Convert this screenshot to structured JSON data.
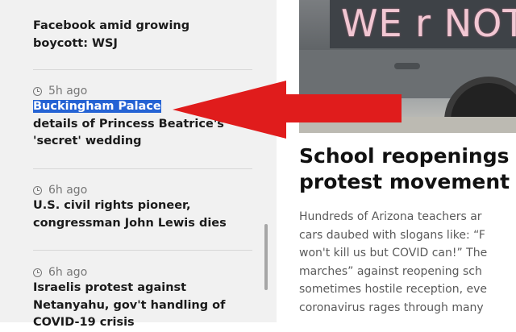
{
  "sidebar": {
    "items": [
      {
        "time": "",
        "headline_lines": [
          "Facebook amid growing",
          "boycott: WSJ"
        ]
      },
      {
        "time": "5h ago",
        "highlighted": "Buckingham Palace",
        "headline_rest_first": " ",
        "headline_lines": [
          "details of Princess Beatrice's",
          "'secret' wedding"
        ]
      },
      {
        "time": "6h ago",
        "headline_lines": [
          "U.S. civil rights pioneer,",
          "congressman John Lewis dies"
        ]
      },
      {
        "time": "6h ago",
        "headline_lines": [
          "Israelis protest against",
          "Netanyahu, gov't handling of",
          "COVID-19 crisis"
        ]
      }
    ]
  },
  "article": {
    "sign_text": "WE r NOT",
    "title_lines": [
      "School reopenings",
      "protest movement"
    ],
    "body_lines": [
      "Hundreds of Arizona teachers ar",
      "cars daubed with slogans like: “F",
      "won't kill us but COVID can!” The",
      "marches” against reopening sch",
      "sometimes hostile reception, eve",
      "coronavirus rages through many"
    ]
  },
  "annotation": {
    "arrow_color": "#e01c1c",
    "icon": "red-arrow-icon"
  },
  "colors": {
    "selection": "#2563d4",
    "sidebar_bg": "#f1f1f1"
  }
}
